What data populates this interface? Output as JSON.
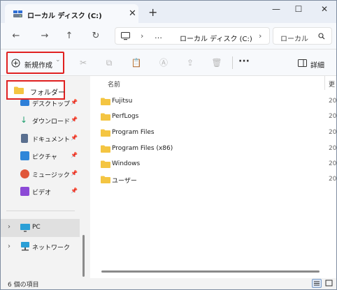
{
  "window": {
    "tab_title": "ローカル ディスク (C:)",
    "tab_close": "✕",
    "tab_add": "+",
    "minimize": "—",
    "maximize": "☐",
    "close": "✕"
  },
  "address": {
    "nav_back": "←",
    "nav_forward": "→",
    "nav_up": "↑",
    "nav_refresh": "↻",
    "separator1": "›",
    "ellipsis": "…",
    "path": "ローカル ディスク (C:)",
    "separator2": "›",
    "search_placeholder": "ローカル"
  },
  "commandbar": {
    "new_label": "新規作成",
    "new_arrow": "⌄",
    "more": "···",
    "details_label": "詳細"
  },
  "sidebar": {
    "highlight_label": "フォルダー",
    "items": [
      {
        "label": "デスクトップ",
        "icon": "desktop-icon",
        "color": "#2e7fd8"
      },
      {
        "label": "ダウンロード",
        "icon": "download-icon",
        "color": "#1f9e6e"
      },
      {
        "label": "ドキュメント",
        "icon": "document-icon",
        "color": "#5a6f8f"
      },
      {
        "label": "ピクチャ",
        "icon": "pictures-icon",
        "color": "#2f86d9"
      },
      {
        "label": "ミュージック",
        "icon": "music-icon",
        "color": "#e0573a"
      },
      {
        "label": "ビデオ",
        "icon": "video-icon",
        "color": "#8c4ad6"
      }
    ],
    "pin": "📌",
    "pc_label": "PC",
    "network_label": "ネットワーク"
  },
  "main": {
    "col_name": "名前",
    "col_date": "更",
    "files": [
      {
        "name": "Fujitsu",
        "date": "20"
      },
      {
        "name": "PerfLogs",
        "date": "20"
      },
      {
        "name": "Program Files",
        "date": "20"
      },
      {
        "name": "Program Files (x86)",
        "date": "20"
      },
      {
        "name": "Windows",
        "date": "20"
      },
      {
        "name": "ユーザー",
        "date": "20"
      }
    ]
  },
  "status": {
    "count": "6 個の項目"
  },
  "colors": {
    "highlight_border": "#e02020",
    "folder_yellow": "#f4c542",
    "accent_blue": "#2f6fd6"
  }
}
